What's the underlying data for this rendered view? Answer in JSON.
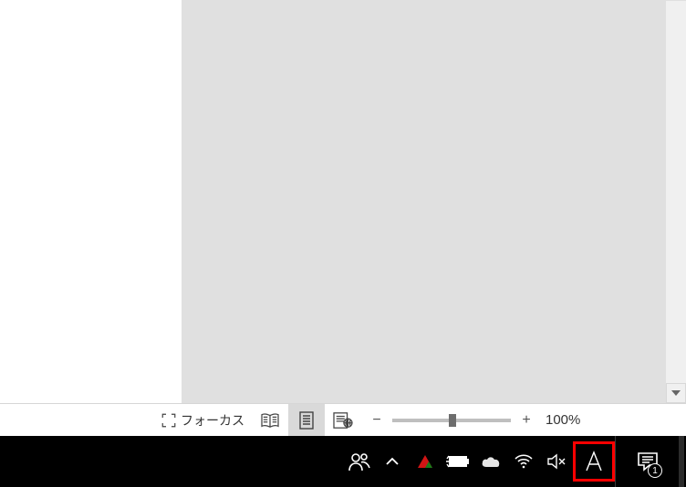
{
  "statusbar": {
    "focus_label": "フォーカス",
    "zoom_minus": "−",
    "zoom_plus": "+",
    "zoom_value": "100%"
  },
  "taskbar": {
    "notification_count": "1"
  }
}
